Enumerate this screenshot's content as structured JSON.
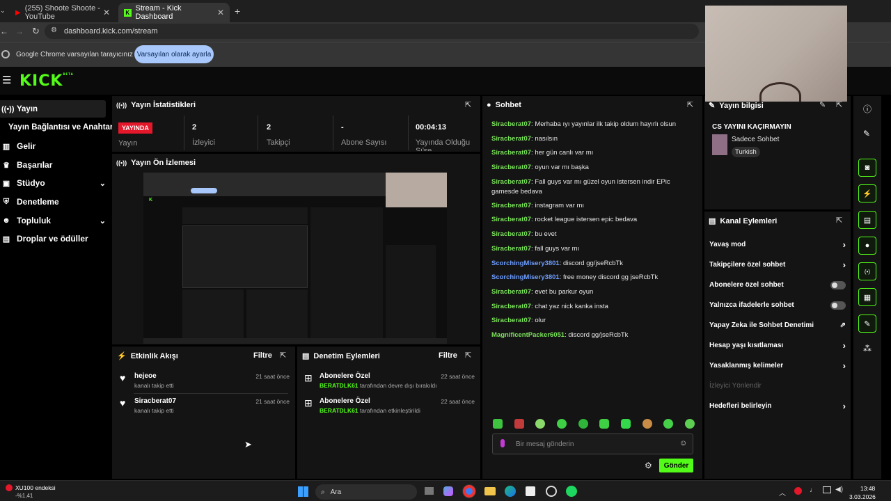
{
  "browser": {
    "tabs": [
      {
        "title": "(255) Shoote Shoote - YouTube"
      },
      {
        "title": "Stream - Kick Dashboard"
      }
    ],
    "url": "dashboard.kick.com/stream",
    "infobar_text": "Google Chrome varsayılan tarayıcınız değil",
    "infobar_button": "Varsayılan olarak ayarla"
  },
  "brand": {
    "logo": "KICK",
    "badge": "BETA"
  },
  "sidebar": {
    "items": [
      {
        "label": "Yayın",
        "icon": "broadcast-icon"
      },
      {
        "label": "Yayın Bağlantısı ve Anahtarı"
      },
      {
        "label": "Gelir",
        "icon": "chart-icon"
      },
      {
        "label": "Başarılar",
        "icon": "trophy-icon"
      },
      {
        "label": "Stüdyo",
        "icon": "studio-icon"
      },
      {
        "label": "Denetleme",
        "icon": "shield-icon"
      },
      {
        "label": "Topluluk",
        "icon": "people-icon"
      },
      {
        "label": "Droplar ve ödüller",
        "icon": "gift-icon"
      }
    ]
  },
  "stats": {
    "title": "Yayın İstatistikleri",
    "items": [
      {
        "value": "YAYINDA",
        "label": "Yayın"
      },
      {
        "value": "2",
        "label": "İzleyici"
      },
      {
        "value": "2",
        "label": "Takipçi"
      },
      {
        "value": "-",
        "label": "Abone Sayısı"
      },
      {
        "value": "00:04:13",
        "label": "Yayında Olduğu Süre"
      }
    ]
  },
  "preview": {
    "title": "Yayın Ön İzlemesi"
  },
  "activity": {
    "title": "Etkinlik Akışı",
    "filter": "Filtre",
    "events": [
      {
        "user": "hejeoe",
        "sub": "kanalı takip etti",
        "time": "21 saat önce"
      },
      {
        "user": "Siracberat07",
        "sub": "kanalı takip etti",
        "time": "21 saat önce"
      }
    ]
  },
  "moderation": {
    "title": "Denetim Eylemleri",
    "filter": "Filtre",
    "events": [
      {
        "title": "Abonelere Özel",
        "actor": "BERATDLK61",
        "sub": " tarafından devre dışı bırakıldı",
        "time": "22 saat önce"
      },
      {
        "title": "Abonelere Özel",
        "actor": "BERATDLK61",
        "sub": " tarafından etkinleştirildi",
        "time": "22 saat önce"
      }
    ]
  },
  "chat": {
    "title": "Sohbet",
    "messages": [
      {
        "user": "Siracberat07",
        "text": " Merhaba ıyı yayınlar ilk takip oldum hayırlı olsun"
      },
      {
        "user": "Siracberat07",
        "text": " nasılsın"
      },
      {
        "user": "Siracberat07",
        "text": " her gün canlı var mı"
      },
      {
        "user": "Siracberat07",
        "text": " oyun var mı başka"
      },
      {
        "user": "Siracberat07",
        "text": " Fall guys var mı güzel oyun istersen indir EPic gamesde bedava"
      },
      {
        "user": "Siracberat07",
        "text": " instagram var mı"
      },
      {
        "user": "Siracberat07",
        "text": " rocket league istersen epic bedava"
      },
      {
        "user": "Siracberat07",
        "text": " bu evet"
      },
      {
        "user": "Siracberat07",
        "text": " fall guys var mı"
      },
      {
        "user": "ScorchingMisery3801",
        "text": " discord gg/jseRcbTk",
        "blue": true
      },
      {
        "user": "ScorchingMisery3801",
        "text": " free money discord gg jseRcbTk",
        "blue": true
      },
      {
        "user": "Siracberat07",
        "text": " evet bu parkur oyun"
      },
      {
        "user": "Siracberat07",
        "text": " chat yaz nick kanka insta"
      },
      {
        "user": "Siracberat07",
        "text": " olur"
      },
      {
        "user": "MagnificentPacker6051",
        "text": " discord gg/jseRcbTk"
      }
    ],
    "placeholder": "Bir mesaj gönderin",
    "send": "Gönder"
  },
  "info": {
    "title": "Yayın bilgisi",
    "stream_title": "CS YAYINI KAÇIRMAYIN",
    "category": "Sadece Sohbet",
    "language": "Turkish"
  },
  "channel_actions": {
    "title": "Kanal Eylemleri",
    "items": [
      {
        "label": "Yavaş mod",
        "kind": "arrow"
      },
      {
        "label": "Takipçilere özel sohbet",
        "kind": "arrow"
      },
      {
        "label": "Abonelere özel sohbet",
        "kind": "toggle"
      },
      {
        "label": "Yalnızca ifadelerle sohbet",
        "kind": "toggle"
      },
      {
        "label": "Yapay Zeka ile Sohbet Denetimi",
        "kind": "ext"
      },
      {
        "label": "Hesap yaşı kısıtlaması",
        "kind": "arrow"
      },
      {
        "label": "Yasaklanmış kelimeler",
        "kind": "arrow"
      },
      {
        "label": "İzleyici Yönlendir",
        "kind": "disabled"
      },
      {
        "label": "Hedefleri belirleyin",
        "kind": "arrow"
      }
    ]
  },
  "taskbar": {
    "ticker_name": "XU100 endeksi",
    "ticker_value": "-%1,41",
    "search": "Ara",
    "time": "13:48",
    "date": "3.03.2026"
  }
}
